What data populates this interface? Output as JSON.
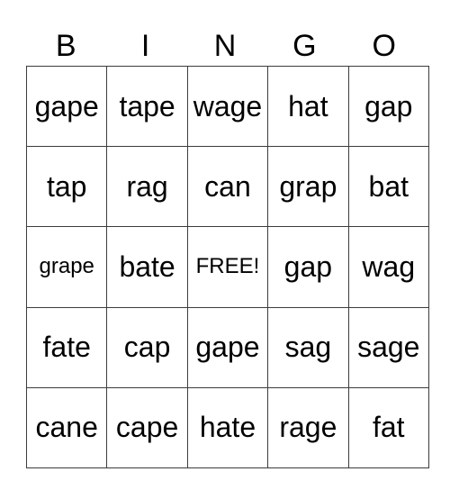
{
  "header": [
    "B",
    "I",
    "N",
    "G",
    "O"
  ],
  "rows": [
    [
      {
        "text": "gape"
      },
      {
        "text": "tape"
      },
      {
        "text": "wage"
      },
      {
        "text": "hat"
      },
      {
        "text": "gap"
      }
    ],
    [
      {
        "text": "tap"
      },
      {
        "text": "rag"
      },
      {
        "text": "can"
      },
      {
        "text": "grap"
      },
      {
        "text": "bat"
      }
    ],
    [
      {
        "text": "grape",
        "small": true
      },
      {
        "text": "bate"
      },
      {
        "text": "FREE!",
        "small": true,
        "free": true
      },
      {
        "text": "gap"
      },
      {
        "text": "wag"
      }
    ],
    [
      {
        "text": "fate"
      },
      {
        "text": "cap"
      },
      {
        "text": "gape"
      },
      {
        "text": "sag"
      },
      {
        "text": "sage"
      }
    ],
    [
      {
        "text": "cane"
      },
      {
        "text": "cape"
      },
      {
        "text": "hate"
      },
      {
        "text": "rage"
      },
      {
        "text": "fat"
      }
    ]
  ],
  "colors": {
    "border": "#3c3c3c",
    "text": "#000000",
    "background": "#ffffff"
  }
}
